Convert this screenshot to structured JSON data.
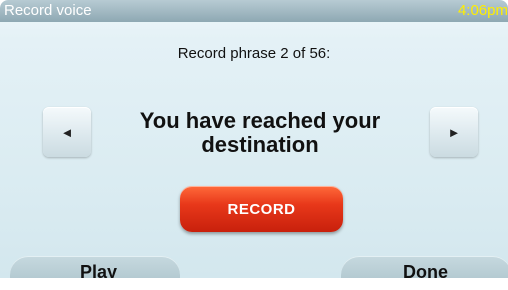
{
  "header": {
    "title": "Record voice",
    "time": "4:06pm"
  },
  "main": {
    "counter": "Record phrase 2 of 56:",
    "phrase_line1": "You have reached your",
    "phrase_line2": "destination",
    "record_label": "RECORD",
    "prev_icon": "◄",
    "next_icon": "►"
  },
  "footer": {
    "play_label": "Play",
    "done_label": "Done"
  },
  "colors": {
    "title_text": "#ffffff",
    "clock_text": "#ffee00",
    "record_button": "#e8381a",
    "background": "#e4f1f6"
  }
}
